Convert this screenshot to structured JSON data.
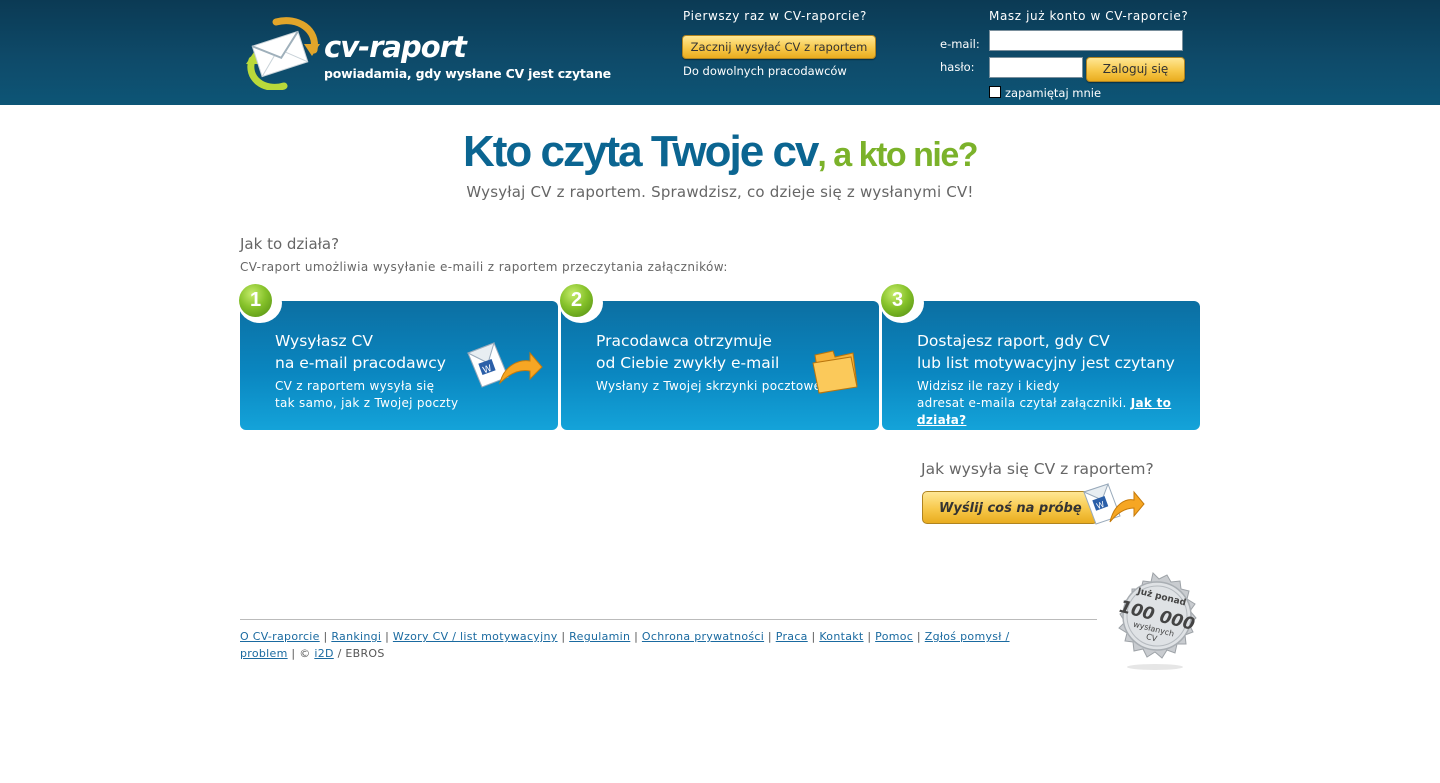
{
  "header": {
    "logo_name": "cv-raport",
    "logo_tagline": "powiadamia, gdy wysłane CV jest czytane",
    "first_time": "Pierwszy raz w CV-raporcie?",
    "start_button": "Zacznij wysyłać CV z raportem",
    "any_employer": "Do dowolnych pracodawców",
    "have_account": "Masz już konto w CV-raporcie?",
    "email_label": "e-mail:",
    "password_label": "hasło:",
    "email_value": "",
    "password_value": "",
    "login_button": "Zaloguj się",
    "remember_me": "zapamiętaj mnie"
  },
  "hero": {
    "title_main": "Kto czyta Twoje cv",
    "title_accent": ", a kto nie?",
    "subtitle": "Wysyłaj CV z raportem. Sprawdzisz, co dzieje się z wysłanymi CV!"
  },
  "how": {
    "title": "Jak to działa?",
    "subtitle": "CV-raport umożliwia wysyłanie e-maili z raportem przeczytania załączników:",
    "steps": [
      {
        "number": "1",
        "title_line1": "Wysyłasz CV",
        "title_line2": "na e-mail pracodawcy",
        "desc_line1": "CV z raportem wysyła się",
        "desc_line2": "tak samo, jak z Twojej poczty",
        "link": ""
      },
      {
        "number": "2",
        "title_line1": "Pracodawca otrzymuje",
        "title_line2": "od Ciebie zwykły e-mail",
        "desc_line1": "Wysłany z Twojej skrzynki pocztowej",
        "desc_line2": "",
        "link": ""
      },
      {
        "number": "3",
        "title_line1": "Dostajesz raport, gdy CV",
        "title_line2": "lub list motywacyjny jest czytany",
        "desc_line1": "Widzisz ile razy i kiedy",
        "desc_line2": "adresat e-maila czytał załączniki.",
        "link": "Jak to działa?"
      }
    ]
  },
  "trial": {
    "question": "Jak wysyła się CV z raportem?",
    "button": "Wyślij coś na próbę"
  },
  "footer": {
    "links": [
      "O CV-raporcie",
      "Rankingi",
      "Wzory CV / list motywacyjny",
      "Regulamin",
      "Ochrona prywatności",
      "Praca",
      "Kontakt",
      "Pomoc",
      "Zgłoś pomysł / problem"
    ],
    "copyright": "©",
    "company_link": "i2D",
    "company_suffix": "EBROS"
  },
  "seal": {
    "line1": "Już ponad",
    "line2": "100 000",
    "line3": "wysłanych",
    "line4": "CV"
  }
}
